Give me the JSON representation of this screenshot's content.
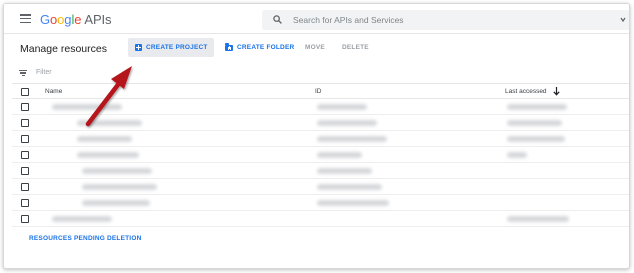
{
  "header": {
    "logo_letters": [
      "G",
      "o",
      "o",
      "g",
      "l",
      "e"
    ],
    "logo_suffix": "APIs",
    "search_placeholder": "Search for APIs and Services",
    "icons": {
      "menu": "menu-icon",
      "search": "search-icon",
      "chevron": "chevron-down-icon"
    }
  },
  "toolbar": {
    "title": "Manage resources",
    "create_project": "CREATE PROJECT",
    "create_folder": "CREATE FOLDER",
    "move": "MOVE",
    "delete": "DELETE"
  },
  "filter": {
    "placeholder": "Filter"
  },
  "table": {
    "columns": {
      "name": "Name",
      "id": "ID",
      "last_accessed": "Last accessed"
    },
    "sort": "descending",
    "row_count": 8
  },
  "footer": {
    "pending_link": "RESOURCES PENDING DELETION"
  },
  "colors": {
    "accent": "#1a73e8",
    "annotation_arrow": "#b4141e"
  }
}
